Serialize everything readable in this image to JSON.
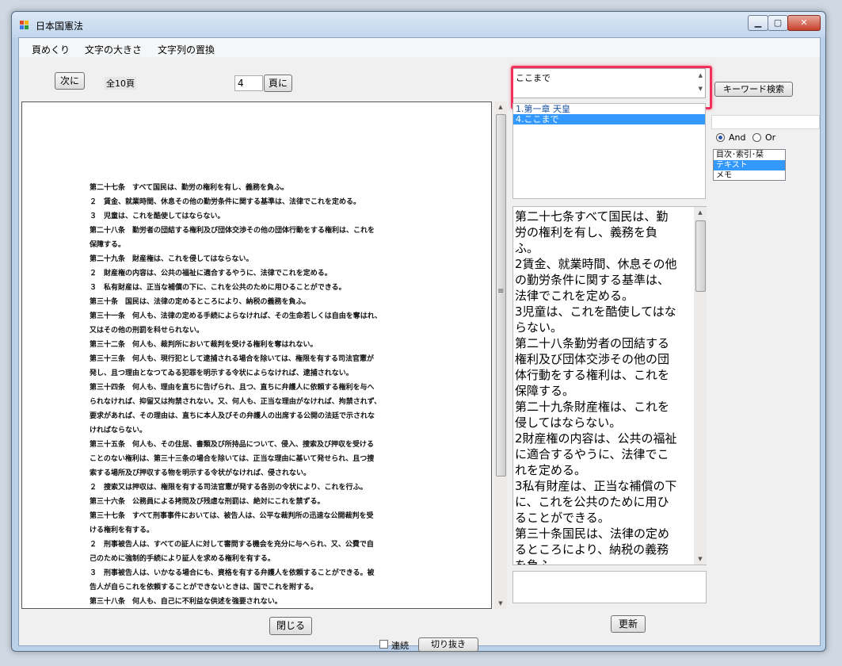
{
  "window": {
    "title": "日本国憲法"
  },
  "menu": [
    "頁めくり",
    "文字の大きさ",
    "文字列の置換"
  ],
  "toolbar": {
    "next_button": "次に",
    "total_pages": "全10頁",
    "page_input": "4",
    "goto_page_button": "頁に"
  },
  "search": {
    "query_text": "ここまで",
    "keyword_search_button": "キーワード検索",
    "results": [
      "1.第一章 天皇",
      "4.ここまで"
    ],
    "selected_result": 1,
    "and_label": "And",
    "or_label": "Or",
    "logic_selected": "And",
    "targets": [
      "目次･索引･栞",
      "テキスト",
      "メモ"
    ],
    "selected_target": 1
  },
  "document_lines": [
    "第二十七条　すべて国民は、勤労の権利を有し、義務を負ふ。",
    "２　賃金、就業時間、休息その他の勤労条件に関する基準は、法律でこれを定める。",
    "３　児童は、これを酷使してはならない。",
    "第二十八条　勤労者の団結する権利及び団体交渉その他の団体行動をする権利は、これを",
    "保障する。",
    "第二十九条　財産権は、これを侵してはならない。",
    "２　財産権の内容は、公共の福祉に適合するやうに、法律でこれを定める。",
    "３　私有財産は、正当な補償の下に、これを公共のために用ひることができる。",
    "第三十条　国民は、法律の定めるところにより、納税の義務を負ふ。",
    "第三十一条　何人も、法律の定める手続によらなければ、その生命若しくは自由を奪はれ、",
    "又はその他の刑罰を科せられない。",
    "第三十二条　何人も、裁判所において裁判を受ける権利を奪はれない。",
    "第三十三条　何人も、現行犯として逮捕される場合を除いては、権限を有する司法官憲が",
    "発し、且つ理由となつてゐる犯罪を明示する令状によらなければ、逮捕されない。",
    "第三十四条　何人も、理由を直ちに告げられ、且つ、直ちに弁護人に依頼する権利を与へ",
    "られなければ、抑留又は拘禁されない。又、何人も、正当な理由がなければ、拘禁されず、",
    "要求があれば、その理由は、直ちに本人及びその弁護人の出席する公開の法廷で示されな",
    "ければならない。",
    "第三十五条　何人も、その住居、書類及び所持品について、侵入、捜索及び押収を受ける",
    "ことのない権利は、第三十三条の場合を除いては、正当な理由に基いて発せられ、且つ捜",
    "索する場所及び押収する物を明示する令状がなければ、侵されない。",
    "２　捜索又は押収は、権限を有する司法官憲が発する各別の令状により、これを行ふ。",
    "第三十六条　公務員による拷問及び残虐な刑罰は、絶対にこれを禁ずる。",
    "第三十七条　すべて刑事事件においては、被告人は、公平な裁判所の迅速な公開裁判を受",
    "ける権利を有する。",
    "２　刑事被告人は、すべての証人に対して審問する機会を充分に与へられ、又、公費で自",
    "己のために強制的手続により証人を求める権利を有する。",
    "３　刑事被告人は、いかなる場合にも、資格を有する弁護人を依頼することができる。被",
    "告人が自らこれを依頼することができないときは、国でこれを附する。",
    "第三十八条　何人も、自己に不利益な供述を強要されない。"
  ],
  "text_lines": [
    "第二十七条すべて国民は、勤",
    "労の権利を有し、義務を負",
    "ふ。",
    "2賃金、就業時間、休息その他",
    "の勤労条件に関する基準は、",
    "法律でこれを定める。",
    "3児童は、これを酷使してはな",
    "らない。",
    "第二十八条勤労者の団結する",
    "権利及び団体交渉その他の団",
    "体行動をする権利は、これを",
    "保障する。",
    "第二十九条財産権は、これを",
    "侵してはならない。",
    "2財産権の内容は、公共の福祉",
    "に適合するやうに、法律でこ",
    "れを定める。",
    "3私有財産は、正当な補償の下",
    "に、これを公共のために用ひ",
    "ることができる。",
    "第三十条国民は、法律の定め",
    "るところにより、納税の義務",
    "を負ふ。"
  ],
  "bottom": {
    "close_button": "閉じる",
    "update_button": "更新",
    "continuous_label": "連続",
    "crop_button": "切り抜き"
  },
  "colors": {
    "selection": "#3399ff",
    "highlight_box": "#f0305a"
  }
}
